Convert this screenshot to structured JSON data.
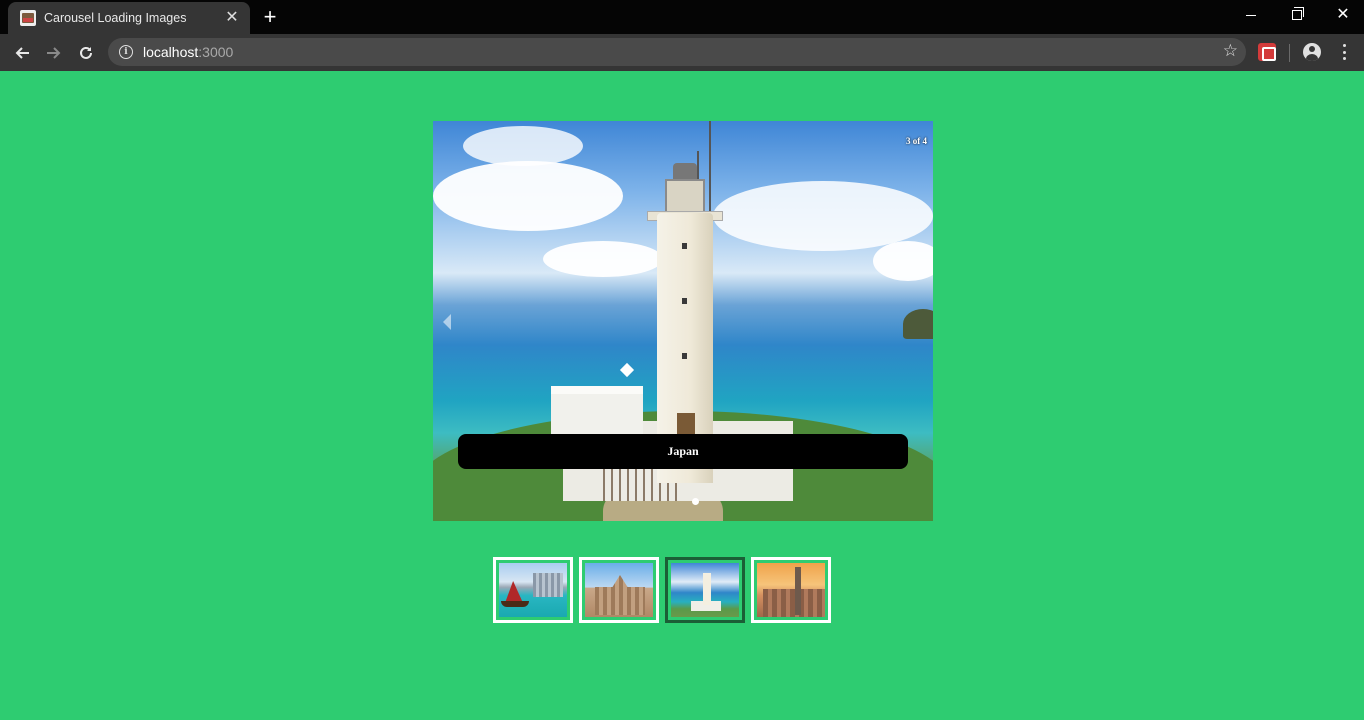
{
  "browser": {
    "tab_title": "Carousel Loading Images",
    "tab_close": "✕",
    "new_tab": "+",
    "url_host": "localhost",
    "url_port": ":3000",
    "icons": [
      "back-arrow-icon",
      "forward-arrow-icon",
      "reload-icon",
      "info-icon",
      "star-icon",
      "extension-icon",
      "profile-icon",
      "menu-icon"
    ]
  },
  "carousel": {
    "counter": "3 of 4",
    "caption": "Japan",
    "current_index": 3,
    "total": 4
  },
  "thumbnails": [
    {
      "subject": "Hong Kong harbor with junk boat",
      "active": false
    },
    {
      "subject": "Ruins of St. Paul's facade",
      "active": false
    },
    {
      "subject": "Lighthouse by the sea",
      "active": true
    },
    {
      "subject": "New York skyline at sunset",
      "active": false
    }
  ],
  "colors": {
    "page_background": "#2ecc71",
    "caption_background": "#000000",
    "thumb_border": "#ffffff",
    "thumb_active_border": "#1b5e36"
  }
}
